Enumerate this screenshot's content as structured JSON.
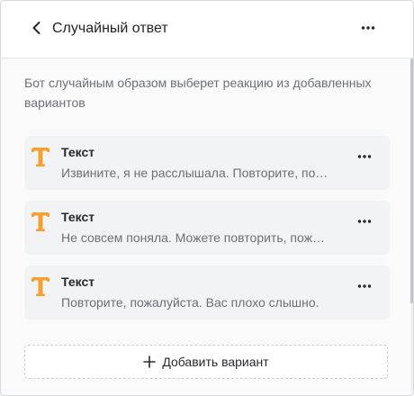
{
  "header": {
    "title": "Случайный ответ",
    "back_icon": "chevron-left-icon",
    "menu_icon": "more-horizontal-icon"
  },
  "description": "Бот случайным образом выберет реакцию из добавленных вариантов",
  "variants": [
    {
      "type_label": "Текст",
      "text": "Извините, я не расслышала. Повторите, пожалуйста.",
      "icon": "text-type-icon"
    },
    {
      "type_label": "Текст",
      "text": "Не совсем поняла. Можете повторить, пожалуйста?",
      "icon": "text-type-icon"
    },
    {
      "type_label": "Текст",
      "text": "Повторите, пожалуйста. Вас плохо слышно.",
      "icon": "text-type-icon"
    }
  ],
  "add_button": {
    "label": "Добавить вариант",
    "icon": "plus-icon"
  },
  "colors": {
    "accent_orange": "#f5a032",
    "text_primary": "#26292d",
    "text_secondary": "#6b7077"
  }
}
